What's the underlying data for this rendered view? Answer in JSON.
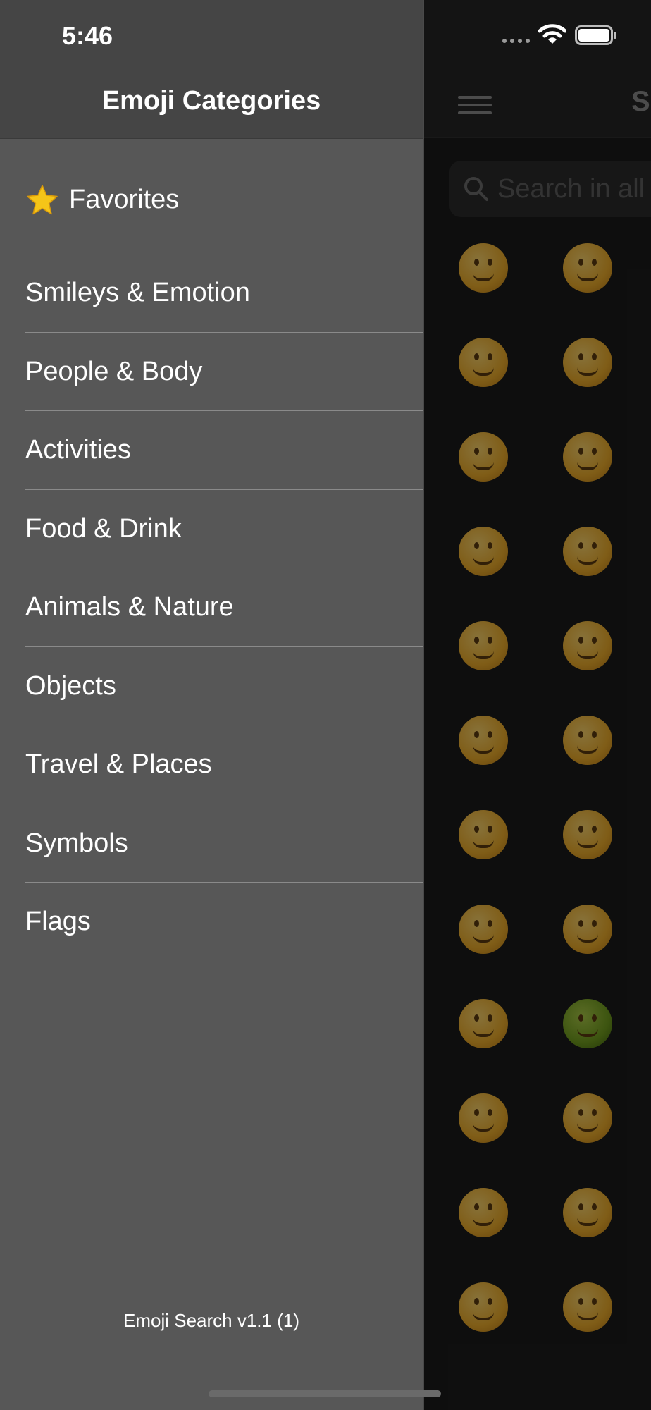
{
  "status_bar": {
    "time": "5:46"
  },
  "main": {
    "title": "S",
    "search": {
      "placeholder": "Search in all e"
    },
    "menu_icon": "hamburger-icon",
    "emoji_rows": [
      [
        "😀",
        "😃"
      ],
      [
        "🤣",
        "😂"
      ],
      [
        "😇",
        "🥰"
      ],
      [
        "☺️",
        "😚"
      ],
      [
        "🤪",
        "😝"
      ],
      [
        "🤔",
        "🤐"
      ],
      [
        "😏",
        "😒"
      ],
      [
        "😔",
        "😪"
      ],
      [
        "🤕",
        "🤢"
      ],
      [
        "🥴",
        "😵"
      ],
      [
        "🤓",
        "🧐"
      ],
      [
        "😮",
        "😯"
      ]
    ]
  },
  "drawer": {
    "title": "Emoji Categories",
    "favorites": {
      "icon": "star-icon",
      "label": "Favorites"
    },
    "categories": [
      {
        "label": "Smileys & Emotion"
      },
      {
        "label": "People & Body"
      },
      {
        "label": "Activities"
      },
      {
        "label": "Food & Drink"
      },
      {
        "label": "Animals & Nature"
      },
      {
        "label": "Objects"
      },
      {
        "label": "Travel & Places"
      },
      {
        "label": "Symbols"
      },
      {
        "label": "Flags"
      }
    ],
    "version": "Emoji Search v1.1 (1)"
  },
  "colors": {
    "drawer_bg": "#575757",
    "drawer_header_bg": "#454545",
    "main_bg": "#1b1b1b",
    "star": "#f5c518"
  }
}
